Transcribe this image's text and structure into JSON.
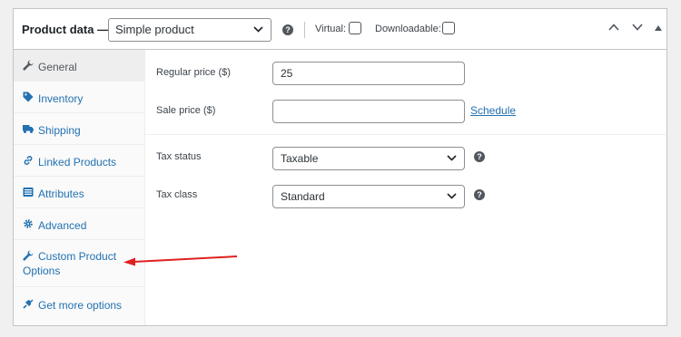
{
  "header": {
    "title": "Product data —",
    "product_type": "Simple product",
    "virtual_label": "Virtual:",
    "downloadable_label": "Downloadable:",
    "virtual_checked": false,
    "downloadable_checked": false
  },
  "sidebar": {
    "items": [
      {
        "label": "General",
        "icon": "wrench-icon",
        "active": true
      },
      {
        "label": "Inventory",
        "icon": "tag-icon"
      },
      {
        "label": "Shipping",
        "icon": "truck-icon"
      },
      {
        "label": "Linked Products",
        "icon": "link-icon"
      },
      {
        "label": "Attributes",
        "icon": "list-icon"
      },
      {
        "label": "Advanced",
        "icon": "gear-icon"
      },
      {
        "label": "Custom Product Options",
        "icon": "wrench-icon"
      },
      {
        "label": "Get more options",
        "icon": "plugin-icon"
      }
    ]
  },
  "general": {
    "regular_price_label": "Regular price ($)",
    "regular_price_value": "25",
    "sale_price_label": "Sale price ($)",
    "sale_price_value": "",
    "schedule_link": "Schedule",
    "tax_status_label": "Tax status",
    "tax_status_value": "Taxable",
    "tax_class_label": "Tax class",
    "tax_class_value": "Standard"
  },
  "colors": {
    "link": "#2271b1",
    "annotation_arrow": "#e02020",
    "active_tab_bg": "#eeeeee"
  }
}
